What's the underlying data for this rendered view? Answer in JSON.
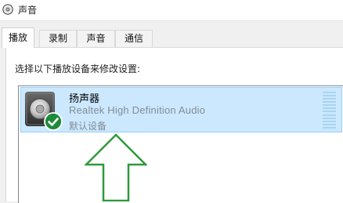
{
  "window": {
    "title": "声音",
    "icon": "speaker-icon"
  },
  "tabs": [
    {
      "label": "播放",
      "active": true
    },
    {
      "label": "录制",
      "active": false
    },
    {
      "label": "声音",
      "active": false
    },
    {
      "label": "通信",
      "active": false
    }
  ],
  "playback": {
    "prompt": "选择以下播放设备来修改设置:",
    "devices": [
      {
        "name": "扬声器",
        "driver": "Realtek High Definition Audio",
        "status": "默认设备",
        "icon": "speaker-icon",
        "badge_icon": "checkmark-icon",
        "selected": true
      }
    ]
  },
  "annotation": {
    "icon": "up-arrow-icon",
    "color": "#2e9a3c"
  },
  "colors": {
    "selection_bg": "#cce8ff",
    "selection_border": "#99d1ff",
    "default_badge": "#1e8a3a"
  }
}
